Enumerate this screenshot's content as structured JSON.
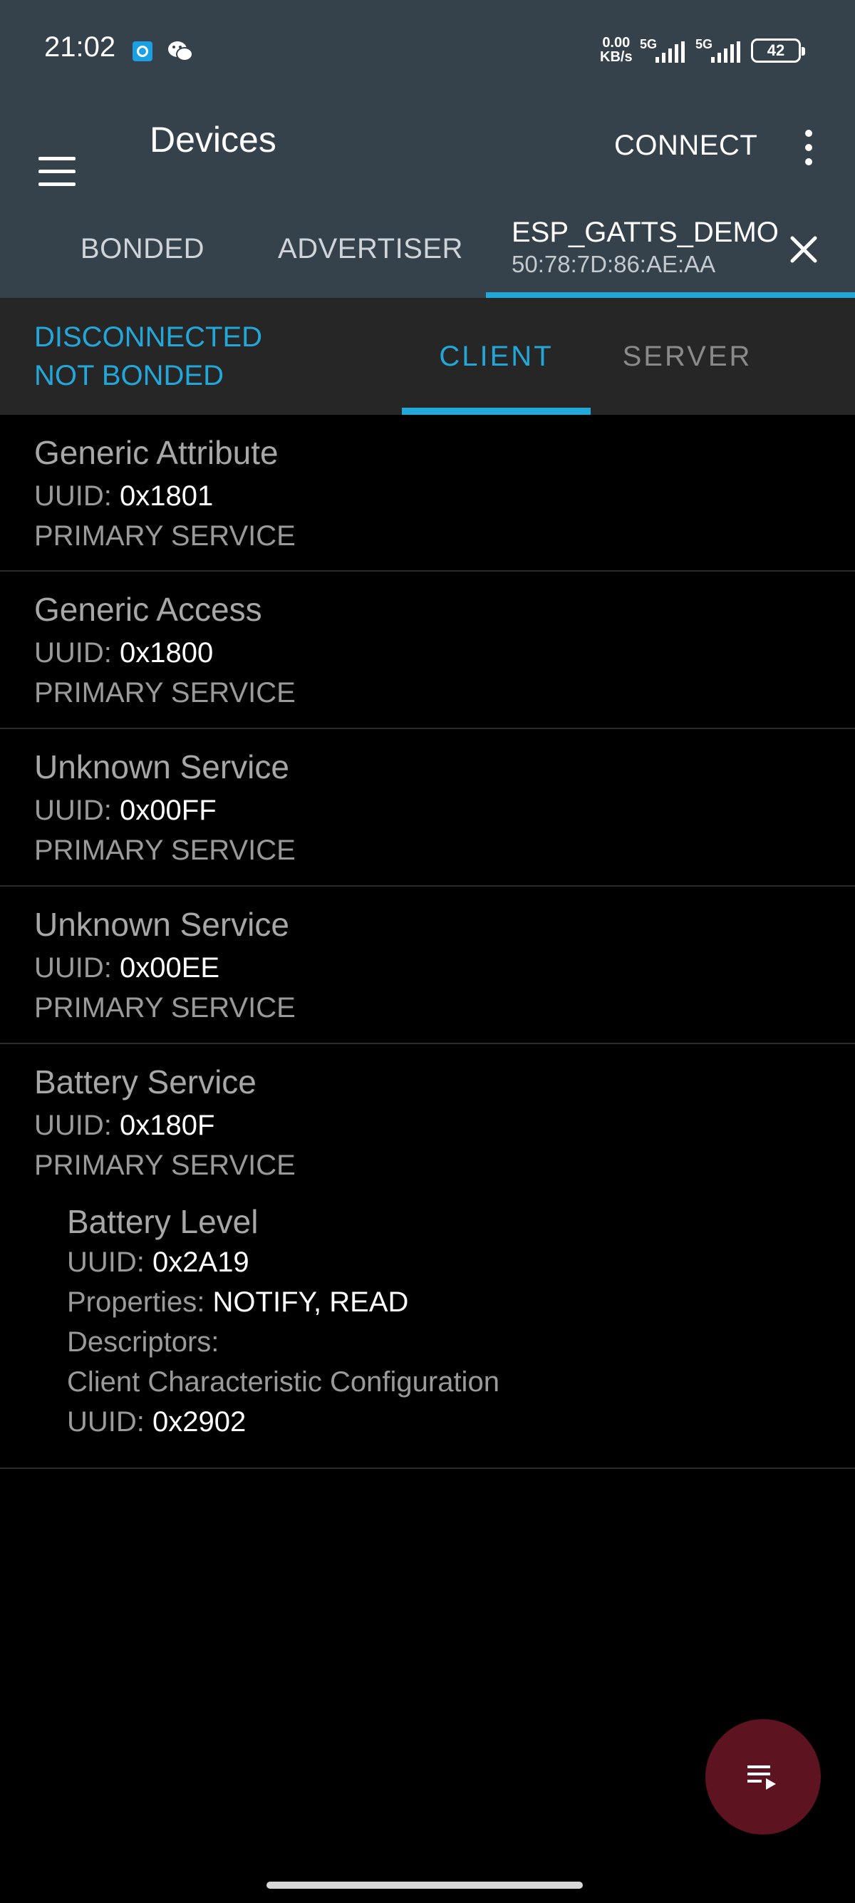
{
  "status_bar": {
    "time": "21:02",
    "net_speed_value": "0.00",
    "net_speed_unit": "KB/s",
    "signal1_label": "5G",
    "signal2_label": "5G",
    "battery": "42"
  },
  "app_bar": {
    "title": "Devices",
    "connect_label": "CONNECT"
  },
  "device_tabs": [
    {
      "label": "BONDED"
    },
    {
      "label": "ADVERTISER"
    }
  ],
  "active_device": {
    "name": "ESP_GATTS_DEMO",
    "mac": "50:78:7D:86:AE:AA"
  },
  "connection": {
    "state": "DISCONNECTED",
    "bond": "NOT BONDED"
  },
  "mode_tabs": {
    "client": "CLIENT",
    "server": "SERVER"
  },
  "labels": {
    "uuid": "UUID:",
    "properties": "Properties:",
    "descriptors": "Descriptors:"
  },
  "services": [
    {
      "name": "Generic Attribute",
      "uuid": "0x1801",
      "type": "PRIMARY SERVICE"
    },
    {
      "name": "Generic Access",
      "uuid": "0x1800",
      "type": "PRIMARY SERVICE"
    },
    {
      "name": "Unknown Service",
      "uuid": "0x00FF",
      "type": "PRIMARY SERVICE"
    },
    {
      "name": "Unknown Service",
      "uuid": "0x00EE",
      "type": "PRIMARY SERVICE"
    },
    {
      "name": "Battery Service",
      "uuid": "0x180F",
      "type": "PRIMARY SERVICE",
      "characteristic": {
        "name": "Battery Level",
        "uuid": "0x2A19",
        "properties": "NOTIFY, READ",
        "descriptor_name": "Client Characteristic Configuration",
        "descriptor_uuid": "0x2902"
      }
    }
  ],
  "colors": {
    "app_bar": "#36424b",
    "accent": "#23a7d8",
    "fab": "#5e1320"
  }
}
